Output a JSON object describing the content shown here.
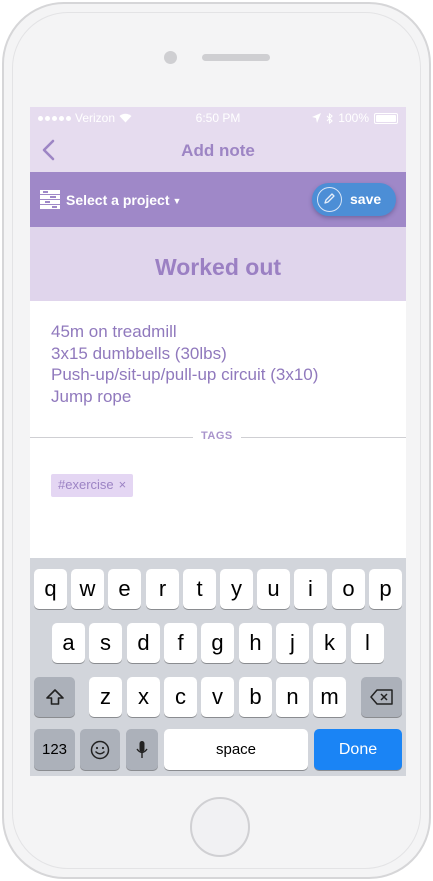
{
  "status_bar": {
    "carrier": "Verizon",
    "time": "6:50 PM",
    "battery": "100%",
    "battery_level": 1.0
  },
  "nav": {
    "title": "Add note",
    "back_icon": "chevron-left-icon"
  },
  "project_bar": {
    "select_label": "Select a project",
    "save_label": "save"
  },
  "note": {
    "title": "Worked out",
    "lines": [
      "45m on treadmill",
      "3x15 dumbbells (30lbs)",
      "Push-up/sit-up/pull-up circuit (3x10)",
      "Jump rope"
    ]
  },
  "tags": {
    "section_label": "TAGS",
    "items": [
      {
        "label": "#exercise",
        "remove": "×"
      }
    ]
  },
  "keyboard": {
    "row1": [
      "q",
      "w",
      "e",
      "r",
      "t",
      "y",
      "u",
      "i",
      "o",
      "p"
    ],
    "row2": [
      "a",
      "s",
      "d",
      "f",
      "g",
      "h",
      "j",
      "k",
      "l"
    ],
    "row3": [
      "z",
      "x",
      "c",
      "v",
      "b",
      "n",
      "m"
    ],
    "numbers_label": "123",
    "space_label": "space",
    "done_label": "Done"
  },
  "colors": {
    "accent": "#9f88c8",
    "title": "#9b80c3",
    "save": "#4c8ed6",
    "done": "#1a84f5"
  }
}
